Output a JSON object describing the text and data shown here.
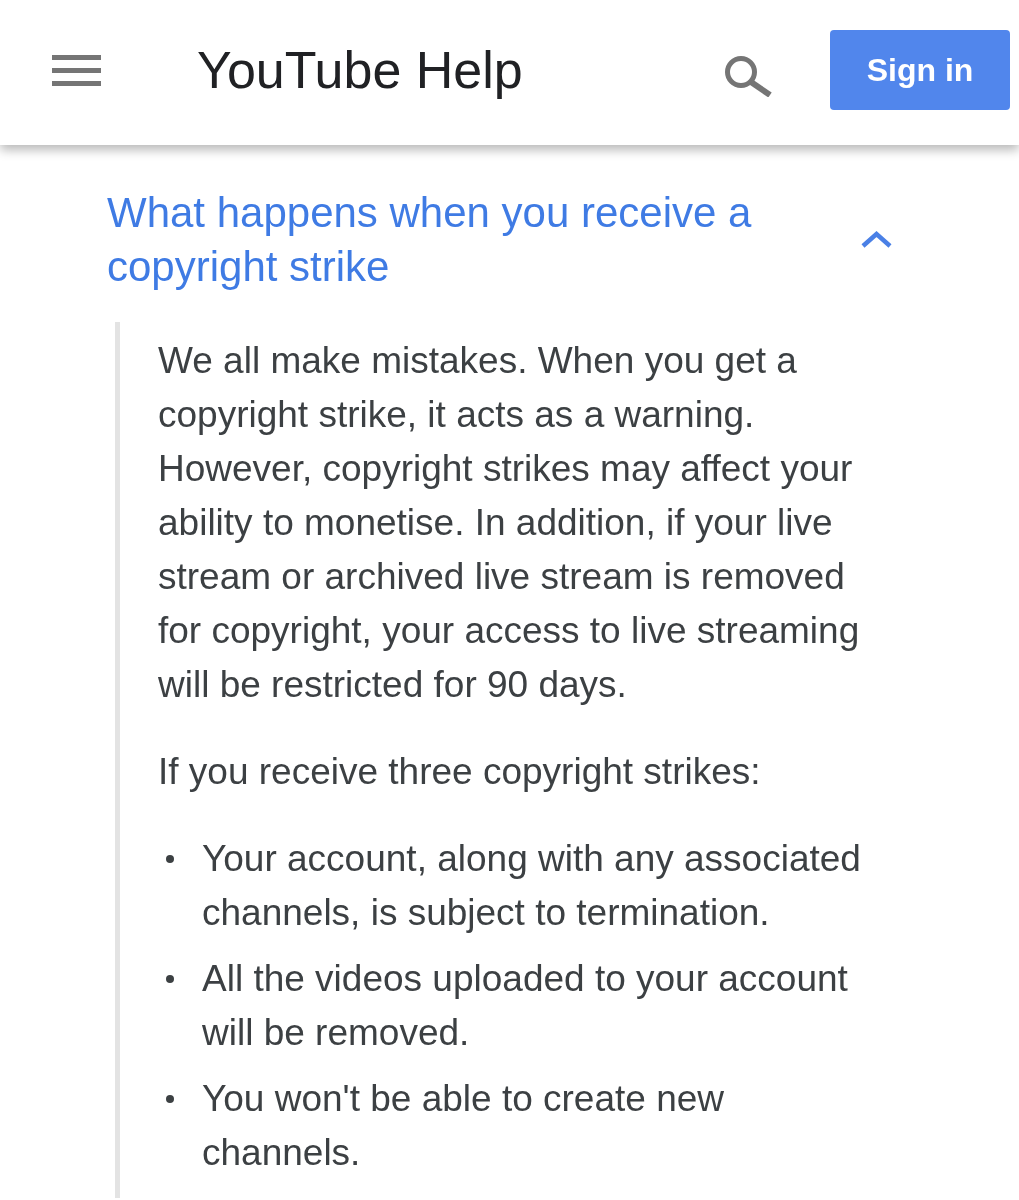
{
  "header": {
    "title": "YouTube Help",
    "sign_in_button": "Sign in"
  },
  "section": {
    "title": "What happens when you receive a copyright strike",
    "expanded": true,
    "paragraphs": [
      "We all make mistakes. When you get a copyright strike, it acts as a warning. However, copyright strikes may affect your ability to monetise. In addition, if your live stream or archived live stream is removed for copyright, your access to live streaming will be restricted for 90 days.",
      "If you receive three copyright strikes:"
    ],
    "bullets": [
      "Your account, along with any associated channels, is subject to termination.",
      "All the videos uploaded to your account will be removed.",
      "You won't be able to create new channels."
    ]
  }
}
